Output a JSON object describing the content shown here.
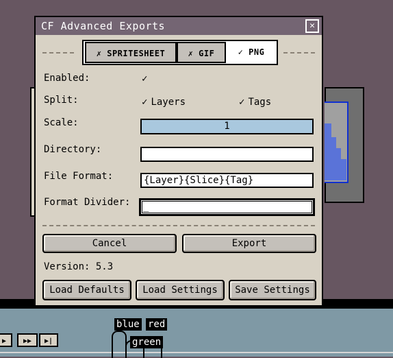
{
  "dialog": {
    "title": "CF Advanced Exports",
    "close_icon": "close-icon",
    "tabs": [
      {
        "label": "SPRITESHEET",
        "mark": "✗",
        "active": false
      },
      {
        "label": "GIF",
        "mark": "✗",
        "active": false
      },
      {
        "label": "PNG",
        "mark": "✓",
        "active": true
      }
    ],
    "enabled": {
      "label": "Enabled:",
      "checked": true,
      "mark": "✓"
    },
    "split": {
      "label": "Split:",
      "layers": {
        "label": "Layers",
        "checked": true,
        "mark": "✓"
      },
      "tags": {
        "label": "Tags",
        "checked": true,
        "mark": "✓"
      }
    },
    "scale": {
      "label": "Scale:",
      "value": "1"
    },
    "directory": {
      "label": "Directory:",
      "value": ""
    },
    "file_format": {
      "label": "File Format:",
      "value": "{Layer}{Slice}{Tag}"
    },
    "format_divider": {
      "label": "Format Divider:",
      "value": "_"
    },
    "buttons": {
      "cancel": "Cancel",
      "export": "Export"
    },
    "version": "Version: 5.3",
    "footer_buttons": {
      "load_defaults": "Load Defaults",
      "load_settings": "Load Settings",
      "save_settings": "Save Settings"
    }
  },
  "timeline": {
    "controls": [
      "▶",
      "▶▶",
      "▶|"
    ],
    "tags": {
      "blue": "blue",
      "red": "red",
      "green": "green"
    }
  },
  "colors": {
    "background": "#675661",
    "titlebar": "#746573",
    "dialog": "#d8d2c5",
    "scale_fill": "#a9c8de",
    "timeline": "#7f99a5",
    "canvas_accent": "#5a73d8"
  }
}
